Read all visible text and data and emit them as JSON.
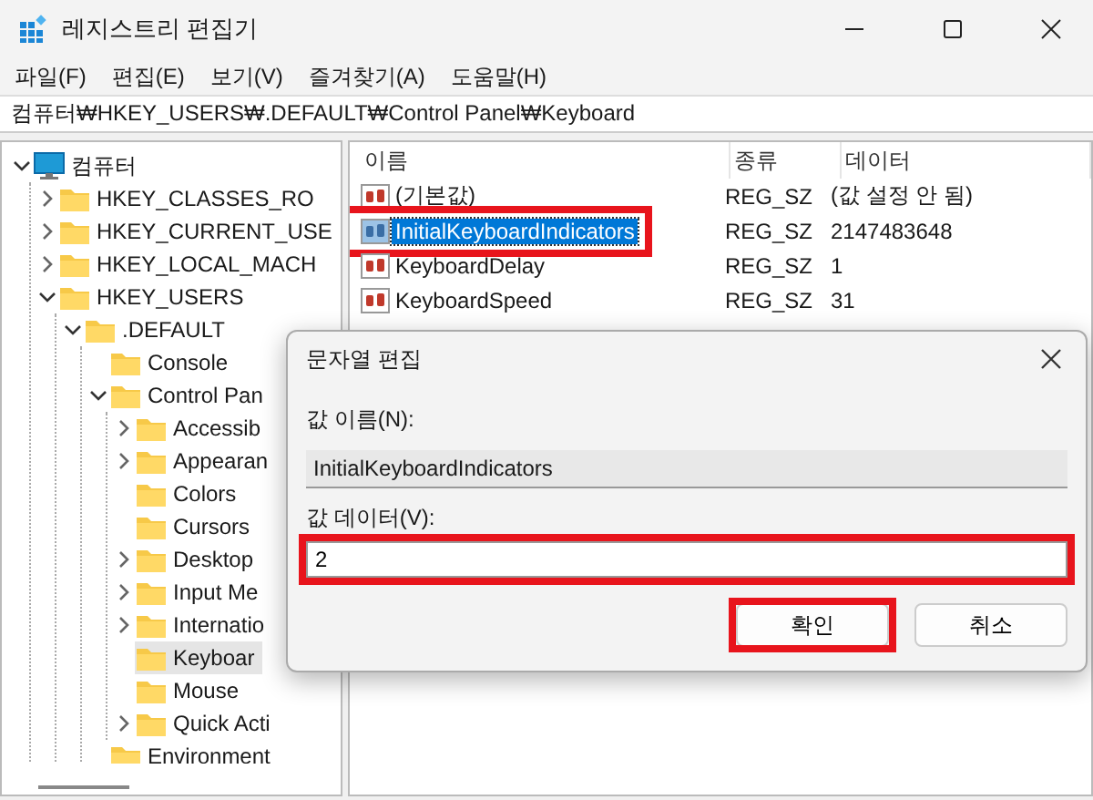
{
  "window": {
    "title": "레지스트리 편집기"
  },
  "menu": [
    "파일(F)",
    "편집(E)",
    "보기(V)",
    "즐겨찾기(A)",
    "도움말(H)"
  ],
  "address": "컴퓨터₩HKEY_USERS₩.DEFAULT₩Control Panel₩Keyboard",
  "tree": [
    {
      "label": "컴퓨터",
      "kind": "computer",
      "expanded": true,
      "selected": false,
      "children": [
        {
          "label": "HKEY_CLASSES_RO",
          "kind": "folder",
          "expanded": false,
          "selected": false
        },
        {
          "label": "HKEY_CURRENT_USE",
          "kind": "folder",
          "expanded": false,
          "selected": false
        },
        {
          "label": "HKEY_LOCAL_MACH",
          "kind": "folder",
          "expanded": false,
          "selected": false
        },
        {
          "label": "HKEY_USERS",
          "kind": "folder",
          "expanded": true,
          "selected": false,
          "children": [
            {
              "label": ".DEFAULT",
              "kind": "folder",
              "expanded": true,
              "selected": false,
              "children": [
                {
                  "label": "Console",
                  "kind": "folder",
                  "selected": false
                },
                {
                  "label": "Control Pan",
                  "kind": "folder",
                  "expanded": true,
                  "selected": false,
                  "children": [
                    {
                      "label": "Accessib",
                      "kind": "folder",
                      "expanded": false,
                      "selected": false
                    },
                    {
                      "label": "Appearan",
                      "kind": "folder",
                      "expanded": false,
                      "selected": false
                    },
                    {
                      "label": "Colors",
                      "kind": "folder",
                      "selected": false
                    },
                    {
                      "label": "Cursors",
                      "kind": "folder",
                      "selected": false
                    },
                    {
                      "label": "Desktop",
                      "kind": "folder",
                      "expanded": false,
                      "selected": false
                    },
                    {
                      "label": "Input Me",
                      "kind": "folder",
                      "expanded": false,
                      "selected": false
                    },
                    {
                      "label": "Internatio",
                      "kind": "folder",
                      "expanded": false,
                      "selected": false
                    },
                    {
                      "label": "Keyboar",
                      "kind": "folder",
                      "selected": true
                    },
                    {
                      "label": "Mouse",
                      "kind": "folder",
                      "selected": false
                    },
                    {
                      "label": "Quick Acti",
                      "kind": "folder",
                      "expanded": false,
                      "selected": false
                    }
                  ]
                },
                {
                  "label": "Environment",
                  "kind": "folder",
                  "selected": false
                }
              ]
            }
          ]
        }
      ]
    }
  ],
  "table": {
    "columns": [
      "이름",
      "종류",
      "데이터"
    ],
    "rows": [
      {
        "name": "(기본값)",
        "type": "REG_SZ",
        "data": "(값 설정 안 됨)",
        "selected": false,
        "highlighted": false
      },
      {
        "name": "InitialKeyboardIndicators",
        "type": "REG_SZ",
        "data": "2147483648",
        "selected": true,
        "highlighted": true
      },
      {
        "name": "KeyboardDelay",
        "type": "REG_SZ",
        "data": "1",
        "selected": false,
        "highlighted": false
      },
      {
        "name": "KeyboardSpeed",
        "type": "REG_SZ",
        "data": "31",
        "selected": false,
        "highlighted": false
      }
    ]
  },
  "dialog": {
    "title": "문자열 편집",
    "name_label": "값 이름(N):",
    "name_value": "InitialKeyboardIndicators",
    "data_label": "값 데이터(V):",
    "data_value": "2",
    "data_highlighted": true,
    "buttons": [
      {
        "label": "확인",
        "highlighted": true
      },
      {
        "label": "취소",
        "highlighted": false
      }
    ]
  }
}
